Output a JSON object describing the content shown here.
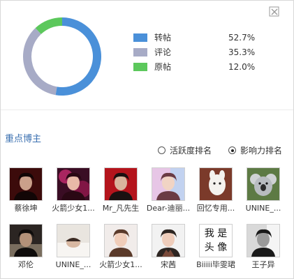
{
  "chart_data": {
    "type": "pie",
    "title": "",
    "categories": [
      "转帖",
      "评论",
      "原帖"
    ],
    "values": [
      52.7,
      35.3,
      12.0
    ],
    "labels": [
      "52.7%",
      "35.3%",
      "12.0%"
    ],
    "colors": [
      "#4a90d9",
      "#a7abc6",
      "#5cc85c"
    ],
    "legend_position": "right"
  },
  "section": {
    "title": "重点博主"
  },
  "sort_options": [
    {
      "label": "活跃度排名",
      "selected": false
    },
    {
      "label": "影响力排名",
      "selected": true
    }
  ],
  "bloggers": [
    {
      "name": "蔡徐坤",
      "icon": "avatar-dark-red"
    },
    {
      "name": "火箭少女1...",
      "icon": "avatar-pink"
    },
    {
      "name": "Mr_凡先生",
      "icon": "avatar-red-portrait"
    },
    {
      "name": "Dear-迪丽...",
      "icon": "avatar-pastel"
    },
    {
      "name": "回忆专用...",
      "icon": "avatar-alpaca"
    },
    {
      "name": "UNINE_...",
      "icon": "avatar-koala"
    },
    {
      "name": "邓伦",
      "icon": "avatar-dark"
    },
    {
      "name": "UNINE_...",
      "icon": "avatar-sleeping"
    },
    {
      "name": "火箭少女1...",
      "icon": "avatar-girl"
    },
    {
      "name": "宋茜",
      "icon": "avatar-woman"
    },
    {
      "name": "Biiiii毕雯珺",
      "icon": "avatar-text",
      "avatar_text": "我 是 头 像"
    },
    {
      "name": "王子异",
      "icon": "avatar-bw"
    }
  ]
}
